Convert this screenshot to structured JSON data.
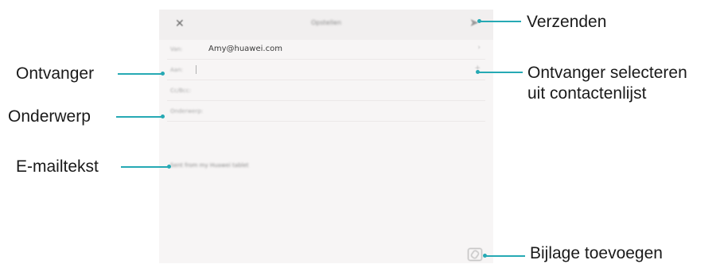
{
  "app": {
    "title": "Opstellen",
    "close_icon": "close-icon",
    "send_icon": "send-icon"
  },
  "fields": {
    "from_label": "Van:",
    "from_value": "Amy@huawei.com",
    "to_label": "Aan:",
    "cc_label": "Cc/Bcc:",
    "subject_label": "Onderwerp:"
  },
  "body_placeholder": "Sent from my Huawei tablet",
  "attachment_icon": "attachment-icon",
  "annotations": {
    "send": "Verzenden",
    "recipient": "Ontvanger",
    "select_recipient_line1": "Ontvanger selecteren",
    "select_recipient_line2": "uit contactenlijst",
    "subject": "Onderwerp",
    "body": "E-mailtekst",
    "attachment": "Bijlage toevoegen"
  },
  "colors": {
    "callout_line": "#26a9b4",
    "screen_bg": "#f7f5f5"
  }
}
